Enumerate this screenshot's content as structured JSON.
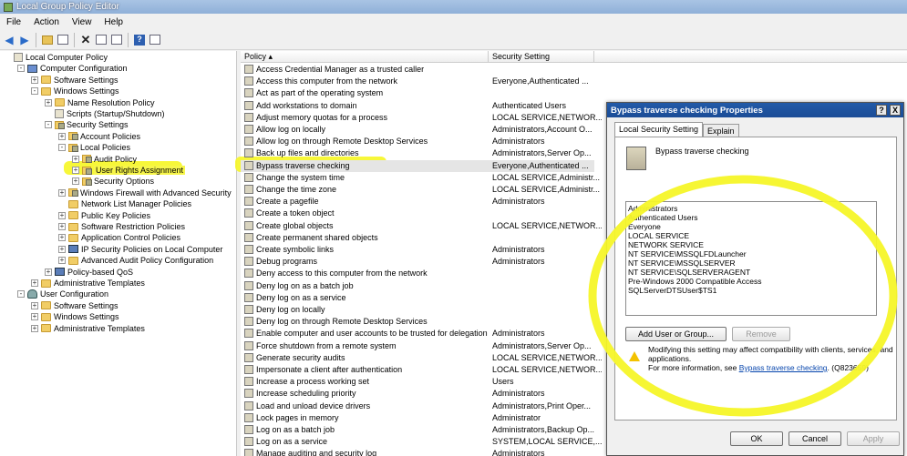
{
  "window": {
    "title": "Local Group Policy Editor"
  },
  "menu": [
    "File",
    "Action",
    "View",
    "Help"
  ],
  "tree": [
    {
      "label": "Local Computer Policy",
      "indent": 0,
      "icon": "scroll-icon",
      "exp": ""
    },
    {
      "label": "Computer Configuration",
      "indent": 1,
      "icon": "computer-icon",
      "exp": "-"
    },
    {
      "label": "Software Settings",
      "indent": 2,
      "icon": "folder-icon",
      "exp": "+"
    },
    {
      "label": "Windows Settings",
      "indent": 2,
      "icon": "folder-icon",
      "exp": "-"
    },
    {
      "label": "Name Resolution Policy",
      "indent": 3,
      "icon": "folder-icon",
      "exp": "+"
    },
    {
      "label": "Scripts (Startup/Shutdown)",
      "indent": 3,
      "icon": "scroll-icon",
      "exp": ""
    },
    {
      "label": "Security Settings",
      "indent": 3,
      "icon": "lock-folder-icon",
      "exp": "-"
    },
    {
      "label": "Account Policies",
      "indent": 4,
      "icon": "lock-folder-icon",
      "exp": "+"
    },
    {
      "label": "Local Policies",
      "indent": 4,
      "icon": "lock-folder-icon",
      "exp": "-"
    },
    {
      "label": "Audit Policy",
      "indent": 5,
      "icon": "lock-folder-icon",
      "exp": "+"
    },
    {
      "label": "User Rights Assignment",
      "indent": 5,
      "icon": "lock-folder-icon",
      "exp": "+",
      "highlight": true
    },
    {
      "label": "Security Options",
      "indent": 5,
      "icon": "lock-folder-icon",
      "exp": "+"
    },
    {
      "label": "Windows Firewall with Advanced Security",
      "indent": 4,
      "icon": "lock-folder-icon",
      "exp": "+"
    },
    {
      "label": "Network List Manager Policies",
      "indent": 4,
      "icon": "folder-icon",
      "exp": ""
    },
    {
      "label": "Public Key Policies",
      "indent": 4,
      "icon": "folder-icon",
      "exp": "+"
    },
    {
      "label": "Software Restriction Policies",
      "indent": 4,
      "icon": "folder-icon",
      "exp": "+"
    },
    {
      "label": "Application Control Policies",
      "indent": 4,
      "icon": "folder-icon",
      "exp": "+"
    },
    {
      "label": "IP Security Policies on Local Computer",
      "indent": 4,
      "icon": "network-icon",
      "exp": "+"
    },
    {
      "label": "Advanced Audit Policy Configuration",
      "indent": 4,
      "icon": "folder-icon",
      "exp": "+"
    },
    {
      "label": "Policy-based QoS",
      "indent": 3,
      "icon": "chart-icon",
      "exp": "+"
    },
    {
      "label": "Administrative Templates",
      "indent": 2,
      "icon": "folder-icon",
      "exp": "+"
    },
    {
      "label": "User Configuration",
      "indent": 1,
      "icon": "user-icon",
      "exp": "-"
    },
    {
      "label": "Software Settings",
      "indent": 2,
      "icon": "folder-icon",
      "exp": "+"
    },
    {
      "label": "Windows Settings",
      "indent": 2,
      "icon": "folder-icon",
      "exp": "+"
    },
    {
      "label": "Administrative Templates",
      "indent": 2,
      "icon": "folder-icon",
      "exp": "+"
    }
  ],
  "list": {
    "columns": [
      "Policy",
      "Security Setting"
    ],
    "rows": [
      [
        "Access Credential Manager as a trusted caller",
        ""
      ],
      [
        "Access this computer from the network",
        "Everyone,Authenticated ..."
      ],
      [
        "Act as part of the operating system",
        ""
      ],
      [
        "Add workstations to domain",
        "Authenticated Users"
      ],
      [
        "Adjust memory quotas for a process",
        "LOCAL SERVICE,NETWOR..."
      ],
      [
        "Allow log on locally",
        "Administrators,Account O..."
      ],
      [
        "Allow log on through Remote Desktop Services",
        "Administrators"
      ],
      [
        "Back up files and directories",
        "Administrators,Server Op..."
      ],
      [
        "Bypass traverse checking",
        "Everyone,Authenticated ..."
      ],
      [
        "Change the system time",
        "LOCAL SERVICE,Administr..."
      ],
      [
        "Change the time zone",
        "LOCAL SERVICE,Administr..."
      ],
      [
        "Create a pagefile",
        "Administrators"
      ],
      [
        "Create a token object",
        ""
      ],
      [
        "Create global objects",
        "LOCAL SERVICE,NETWOR..."
      ],
      [
        "Create permanent shared objects",
        ""
      ],
      [
        "Create symbolic links",
        "Administrators"
      ],
      [
        "Debug programs",
        "Administrators"
      ],
      [
        "Deny access to this computer from the network",
        ""
      ],
      [
        "Deny log on as a batch job",
        ""
      ],
      [
        "Deny log on as a service",
        ""
      ],
      [
        "Deny log on locally",
        ""
      ],
      [
        "Deny log on through Remote Desktop Services",
        ""
      ],
      [
        "Enable computer and user accounts to be trusted for delegation",
        "Administrators"
      ],
      [
        "Force shutdown from a remote system",
        "Administrators,Server Op..."
      ],
      [
        "Generate security audits",
        "LOCAL SERVICE,NETWOR..."
      ],
      [
        "Impersonate a client after authentication",
        "LOCAL SERVICE,NETWOR..."
      ],
      [
        "Increase a process working set",
        "Users"
      ],
      [
        "Increase scheduling priority",
        "Administrators"
      ],
      [
        "Load and unload device drivers",
        "Administrators,Print Oper..."
      ],
      [
        "Lock pages in memory",
        "Administrator"
      ],
      [
        "Log on as a batch job",
        "Administrators,Backup Op..."
      ],
      [
        "Log on as a service",
        "SYSTEM,LOCAL SERVICE,..."
      ],
      [
        "Manage auditing and security log",
        "Administrators"
      ]
    ],
    "selected_index": 8
  },
  "dialog": {
    "title": "Bypass traverse checking Properties",
    "help_btn": "?",
    "close_btn": "X",
    "tabs": [
      "Local Security Setting",
      "Explain"
    ],
    "policy_name": "Bypass traverse checking",
    "members": [
      "Administrators",
      "Authenticated Users",
      "Everyone",
      "LOCAL SERVICE",
      "NETWORK SERVICE",
      "NT SERVICE\\MSSQLFDLauncher",
      "NT SERVICE\\MSSQLSERVER",
      "NT SERVICE\\SQLSERVERAGENT",
      "Pre-Windows 2000 Compatible Access",
      "SQLServerDTSUser$TS1"
    ],
    "add_btn": "Add User or Group...",
    "remove_btn": "Remove",
    "warning_line1": "Modifying this setting may affect compatibility with clients, services, and applications.",
    "warning_line2_prefix": "For more information, see ",
    "warning_link": "Bypass traverse checking",
    "warning_line2_suffix": ". (Q823659)",
    "ok": "OK",
    "cancel": "Cancel",
    "apply": "Apply"
  },
  "colors": {
    "highlight": "#f6f628",
    "title_bar": "#1b4c96"
  }
}
